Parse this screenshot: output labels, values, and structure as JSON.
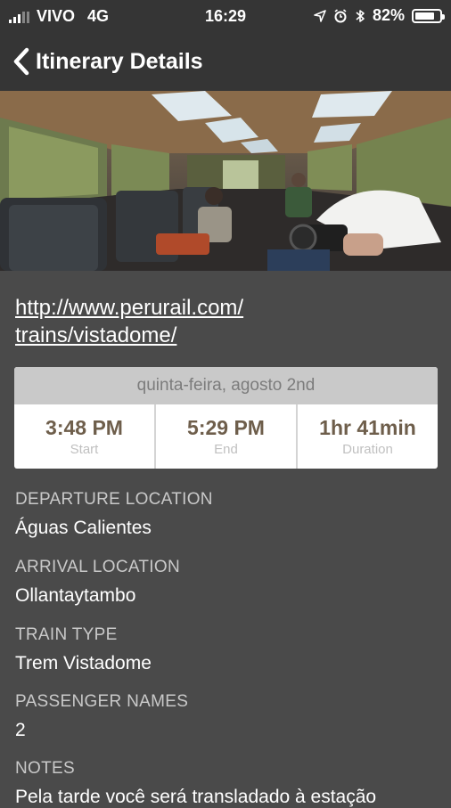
{
  "status_bar": {
    "carrier": "VIVO",
    "network": "4G",
    "time": "16:29",
    "battery": "82%",
    "battery_level": 0.82
  },
  "nav": {
    "title": "Itinerary Details",
    "back_icon": "chevron-left-icon"
  },
  "hero": {
    "icon": "train-interior-photo"
  },
  "link": {
    "line1": "http://www.perurail.com/",
    "line2": "trains/vistadome/"
  },
  "schedule": {
    "date": "quinta-feira, agosto 2nd",
    "start": {
      "value": "3:48 PM",
      "label": "Start"
    },
    "end": {
      "value": "5:29 PM",
      "label": "End"
    },
    "duration": {
      "value": "1hr 41min",
      "label": "Duration"
    }
  },
  "details": [
    {
      "label": "DEPARTURE LOCATION",
      "value": "Águas Calientes"
    },
    {
      "label": "ARRIVAL LOCATION",
      "value": "Ollantaytambo"
    },
    {
      "label": "TRAIN TYPE",
      "value": "Trem Vistadome"
    },
    {
      "label": "PASSENGER NAMES",
      "value": "2"
    },
    {
      "label": "NOTES",
      "value": "Pela tarde você será transladado à estação"
    }
  ],
  "colors": {
    "background": "#4a4a4a",
    "bar": "#353535",
    "accent_brown": "#6e5e4b"
  }
}
